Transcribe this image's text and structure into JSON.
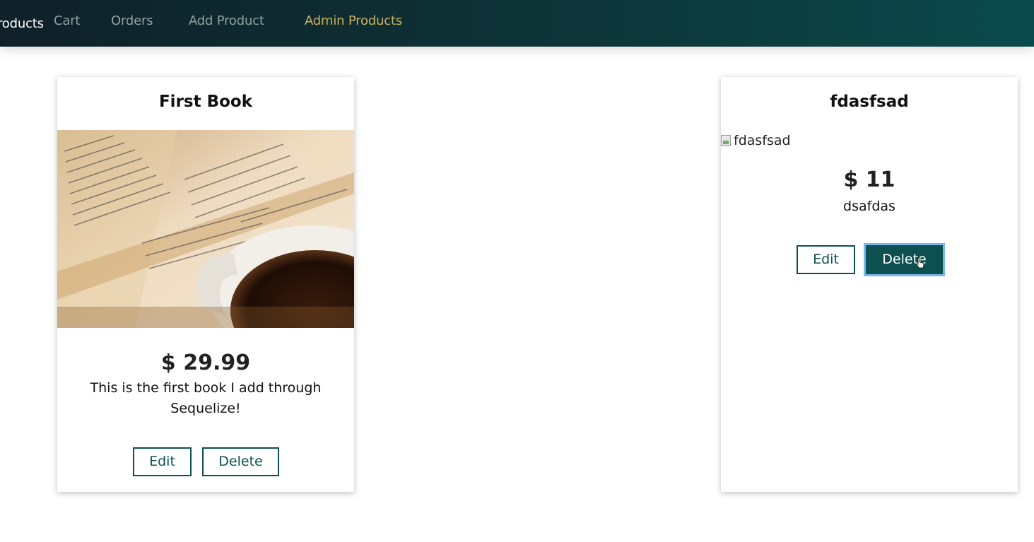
{
  "nav": {
    "partial_label": "roducts",
    "items": [
      {
        "label": "Cart"
      },
      {
        "label": "Orders"
      },
      {
        "label": "Add Product"
      },
      {
        "label": "Admin Products"
      }
    ]
  },
  "products": [
    {
      "title": "First Book",
      "price": "$ 29.99",
      "description": "This is the first book I add through Sequelize!",
      "edit_label": "Edit",
      "delete_label": "Delete"
    },
    {
      "title": "fdasfsad",
      "image_alt": "fdasfsad",
      "price": "$ 11",
      "description": "dsafdas",
      "edit_label": "Edit",
      "delete_label": "Delete"
    }
  ],
  "colors": {
    "header_start": "#0f2028",
    "header_end": "#0b4a4c",
    "active_nav": "#c9b05f",
    "button": "#0e4f4f",
    "focus_ring": "#79b6ea"
  }
}
